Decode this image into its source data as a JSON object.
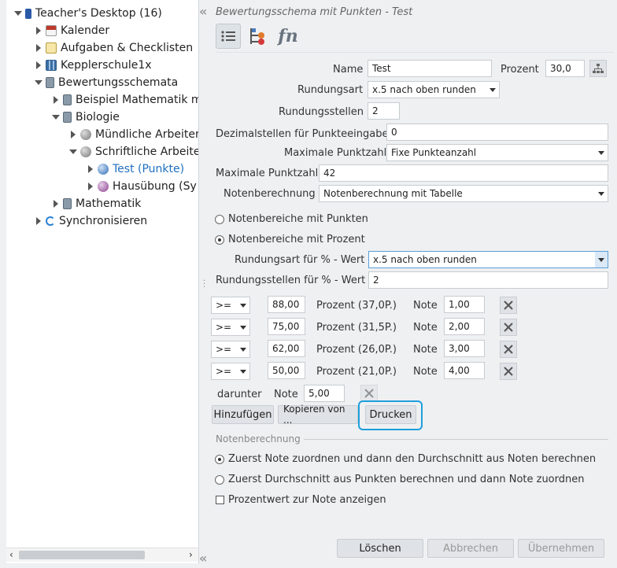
{
  "sidebar": {
    "items": [
      {
        "label": "Teacher's Desktop (16)",
        "icon": "book-icon"
      },
      {
        "label": "Kalender",
        "icon": "calendar-icon"
      },
      {
        "label": "Aufgaben & Checklisten",
        "icon": "checklist-icon"
      },
      {
        "label": "Kepplerschule1x",
        "icon": "building-icon"
      },
      {
        "label": "Bewertungsschemata",
        "icon": "calculator-icon"
      },
      {
        "label": "Beispiel Mathematik m",
        "icon": "calculator-icon"
      },
      {
        "label": "Biologie",
        "icon": "calculator-icon"
      },
      {
        "label": "Mündliche Arbeiter",
        "icon": "gray-sphere-icon"
      },
      {
        "label": "Schriftliche Arbeite",
        "icon": "gray-sphere-icon"
      },
      {
        "label": "Test (Punkte)",
        "icon": "blue-sphere-icon"
      },
      {
        "label": "Hausübung (Sy",
        "icon": "purple-sphere-icon"
      },
      {
        "label": "Mathematik",
        "icon": "calculator-icon"
      },
      {
        "label": "Synchronisieren",
        "icon": "sync-icon"
      }
    ]
  },
  "title": "Bewertungsschema mit Punkten - Test",
  "form": {
    "name_label": "Name",
    "name_value": "Test",
    "prozent_label": "Prozent",
    "prozent_value": "30,0",
    "rundungsart_label": "Rundungsart",
    "rundungsart_value": "x.5 nach oben runden",
    "rundungsstellen_label": "Rundungsstellen",
    "rundungsstellen_value": "2",
    "dezimal_label": "Dezimalstellen für Punkteeingabe",
    "dezimal_value": "0",
    "maxpunkt_mode_label": "Maximale Punktzahl",
    "maxpunkt_mode_value": "Fixe Punkteanzahl",
    "maxpunkt_label": "Maximale Punktzahl",
    "maxpunkt_value": "42",
    "notenber_label": "Notenberechnung",
    "notenber_value": "Notenberechnung mit Tabelle",
    "radio_punkte": "Notenbereiche mit Punkten",
    "radio_prozent": "Notenbereiche mit Prozent",
    "rund_pct_label": "Rundungsart für % - Wert",
    "rund_pct_value": "x.5 nach oben runden",
    "rundst_pct_label": "Rundungsstellen für % - Wert",
    "rundst_pct_value": "2"
  },
  "grades": [
    {
      "op": ">=",
      "value": "88,00",
      "prozent": "Prozent (37,0P.)",
      "note_label": "Note",
      "note": "1,00"
    },
    {
      "op": ">=",
      "value": "75,00",
      "prozent": "Prozent (31,5P.)",
      "note_label": "Note",
      "note": "2,00"
    },
    {
      "op": ">=",
      "value": "62,00",
      "prozent": "Prozent (26,0P.)",
      "note_label": "Note",
      "note": "3,00"
    },
    {
      "op": ">=",
      "value": "50,00",
      "prozent": "Prozent (21,0P.)",
      "note_label": "Note",
      "note": "4,00"
    }
  ],
  "darunter": {
    "label": "darunter",
    "note_label": "Note",
    "note": "5,00"
  },
  "buttons": {
    "hinzufuegen": "Hinzufügen",
    "kopieren": "Kopieren von ...",
    "drucken": "Drucken",
    "loeschen": "Löschen",
    "abbrechen": "Abbrechen",
    "uebernehmen": "Übernehmen"
  },
  "notenberechnung": {
    "section_title": "Notenberechnung",
    "opt1": "Zuerst Note zuordnen und dann den Durchschnitt aus Noten berechnen",
    "opt2": "Zuerst Durchschnitt aus Punkten berechnen und dann Note zuordnen",
    "check": "Prozentwert zur Note anzeigen"
  },
  "colors": {
    "accent": "#1f6fbf",
    "focus_ring": "#1e9fdc"
  }
}
